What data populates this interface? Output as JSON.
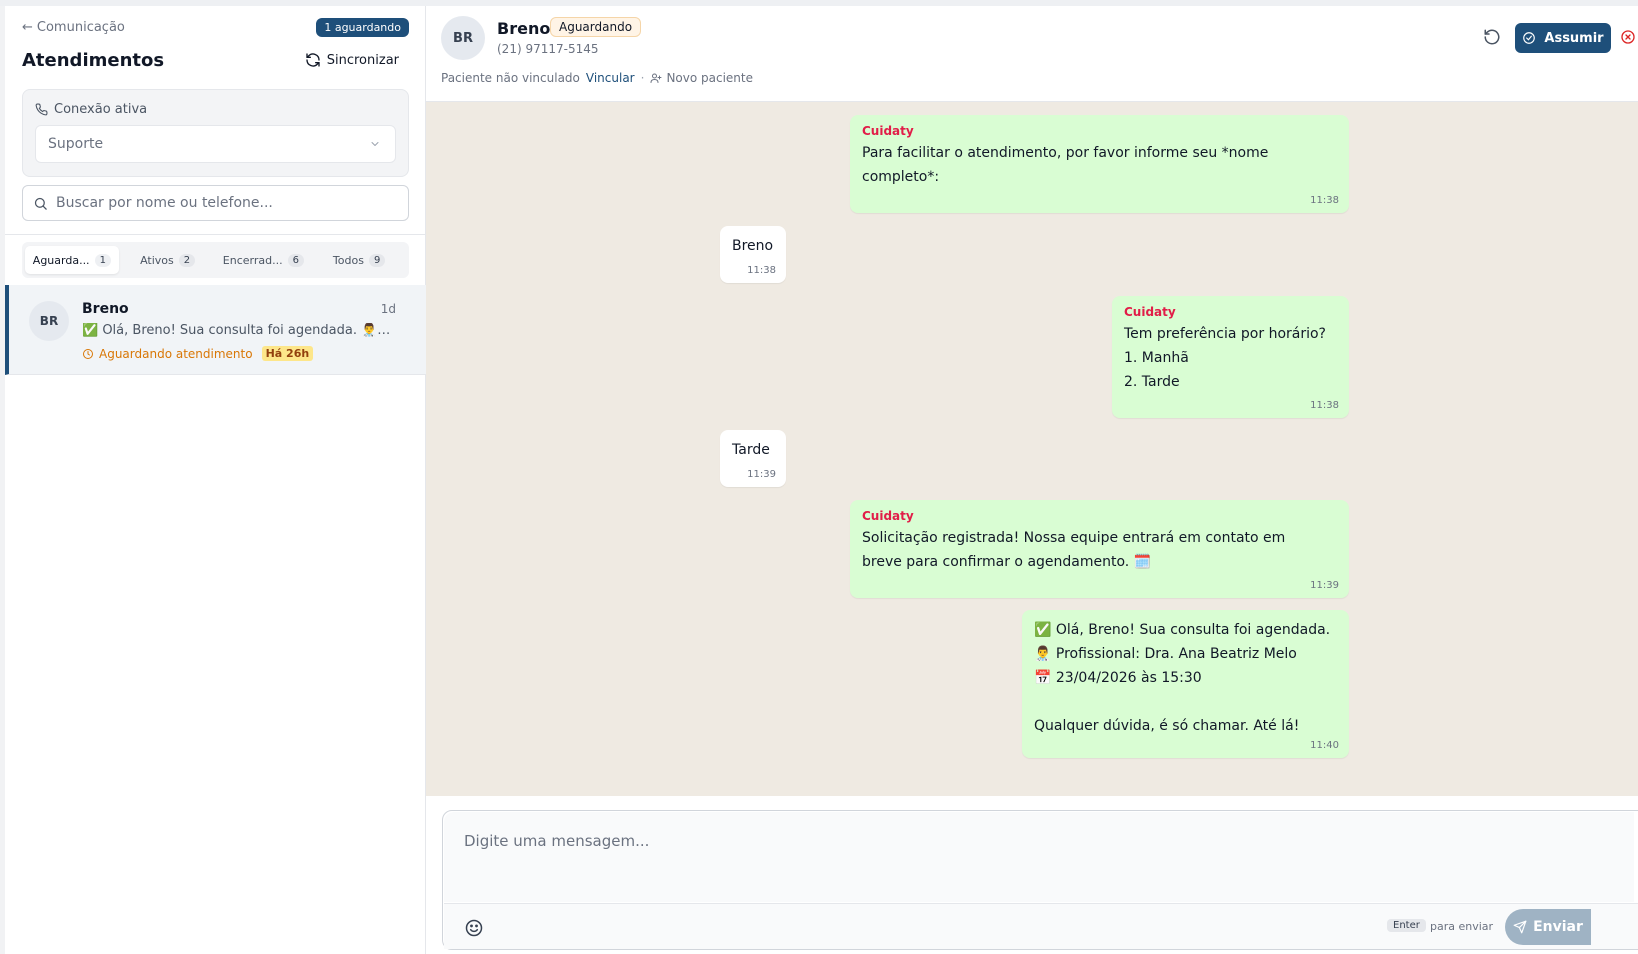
{
  "sidebar": {
    "back_label": "Comunicação",
    "pending_badge": "1 aguardando",
    "title": "Atendimentos",
    "sync_label": "Sincronizar",
    "connection": {
      "label": "Conexão ativa",
      "selected": "Suporte"
    },
    "search": {
      "placeholder": "Buscar por nome ou telefone..."
    },
    "tabs": [
      {
        "label": "Aguarda...",
        "count": "1",
        "active": true
      },
      {
        "label": "Ativos",
        "count": "2",
        "active": false
      },
      {
        "label": "Encerrad...",
        "count": "6",
        "active": false
      },
      {
        "label": "Todos",
        "count": "9",
        "active": false
      }
    ],
    "conversations": [
      {
        "initials": "BR",
        "name": "Breno",
        "time": "1d",
        "preview": "✅ Olá, Breno! Sua consulta foi agendada. 👨‍⚕️ Profissional: Dra. Ana Beatriz Melo",
        "status": "Aguardando atendimento",
        "age": "Há 26h"
      }
    ]
  },
  "chat": {
    "header": {
      "initials": "BR",
      "name": "Breno",
      "status": "Aguardando",
      "phone": "(21) 97117-5145",
      "unlinked": "Paciente não vinculado",
      "link_label": "Vincular",
      "separator": "·",
      "new_patient_label": "Novo paciente",
      "assume_label": "Assumir"
    },
    "messages": [
      {
        "dir": "out",
        "sender": "Cuidaty",
        "lines": [
          "Para facilitar o atendimento, por favor informe seu *nome",
          "completo*:"
        ],
        "time": "11:38"
      },
      {
        "dir": "in",
        "sender": "",
        "lines": [
          "Breno"
        ],
        "time": "11:38"
      },
      {
        "dir": "out",
        "sender": "Cuidaty",
        "lines": [
          "Tem preferência por horário?",
          "1. Manhã",
          "2. Tarde"
        ],
        "time": "11:38"
      },
      {
        "dir": "in",
        "sender": "",
        "lines": [
          "Tarde"
        ],
        "time": "11:39"
      },
      {
        "dir": "out",
        "sender": "Cuidaty",
        "lines": [
          "Solicitação registrada! Nossa equipe entrará em contato em",
          "breve para confirmar o agendamento. 🗓️"
        ],
        "time": "11:39"
      },
      {
        "dir": "out",
        "sender": "",
        "lines": [
          "✅ Olá, Breno! Sua consulta foi agendada.",
          "👨‍⚕️ Profissional: Dra. Ana Beatriz Melo",
          "📅 23/04/2026 às 15:30",
          "",
          "Qualquer dúvida, é só chamar. Até lá!"
        ],
        "time": "11:40"
      }
    ],
    "composer": {
      "placeholder": "Digite uma mensagem...",
      "enter_key": "Enter",
      "enter_hint": "para enviar",
      "send_label": "Enviar"
    }
  },
  "colors": {
    "primary": "#1e4f7a",
    "outgoing_bubble": "#d9fdd3",
    "chat_bg": "#efeae2",
    "sender": "#e11d48",
    "waiting": "#d97706"
  }
}
